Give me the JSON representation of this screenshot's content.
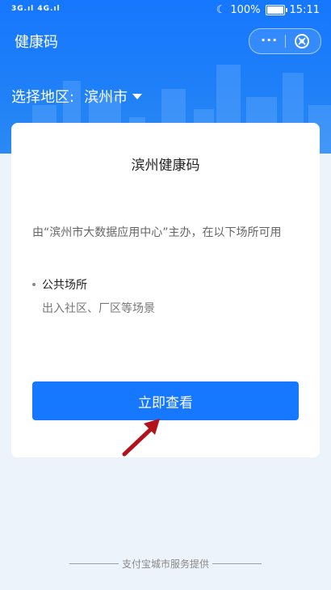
{
  "status_bar": {
    "signal_left": "3G",
    "signal_right": "4G",
    "battery_percent": "100%",
    "time": "15:11"
  },
  "header": {
    "title": "健康码",
    "more_label": "···",
    "region_label": "选择地区:",
    "region_value": "滨州市"
  },
  "card": {
    "title": "滨州健康码",
    "description": "由“滨州市大数据应用中心”主办，在以下场所可用",
    "bullet_title": "公共场所",
    "bullet_subtitle": "出入社区、厂区等场景",
    "button_label": "立即查看"
  },
  "footer": {
    "text": "支付宝城市服务提供"
  },
  "colors": {
    "primary": "#1677ff",
    "background": "#edf3fb"
  }
}
